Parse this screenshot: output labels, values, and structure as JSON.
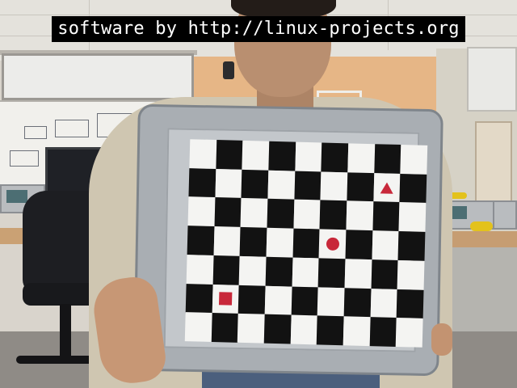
{
  "overlay": {
    "caption": "software by http://linux-projects.org"
  },
  "scene": {
    "board_rows": 7,
    "board_cols": 9,
    "colors": {
      "dark_square": "#121212",
      "light_square": "#f4f4f2",
      "marker": "#c8283a",
      "case": "#a9aeb3",
      "caption_bg": "#000000",
      "caption_text": "#ffffff"
    },
    "markers": [
      {
        "shape": "triangle",
        "row": 1,
        "col": 7
      },
      {
        "shape": "circle",
        "row": 3,
        "col": 5
      },
      {
        "shape": "square",
        "row": 5,
        "col": 1
      }
    ]
  }
}
